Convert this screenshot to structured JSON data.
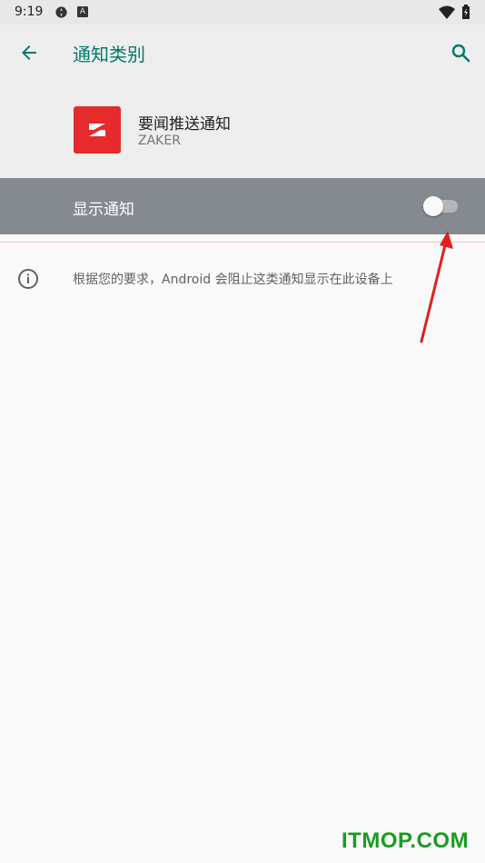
{
  "status_bar": {
    "time": "9:19",
    "icons": [
      "settings-gear-icon",
      "a-badge-icon",
      "wifi-icon",
      "battery-charging-icon"
    ]
  },
  "app_bar": {
    "title": "通知类别",
    "back_icon": "arrow-left-icon",
    "search_icon": "search-icon"
  },
  "header": {
    "app_name": "要闻推送通知",
    "app_sub": "ZAKER",
    "app_icon_color": "#e52b2b"
  },
  "toggle": {
    "label": "显示通知",
    "state": "off"
  },
  "info": {
    "text": "根据您的要求，Android 会阻止这类通知显示在此设备上"
  },
  "watermark": "ITMOP.COM",
  "colors": {
    "accent": "#00796b",
    "toggle_row_bg": "#848a90",
    "app_icon": "#e52b2b",
    "annotation_arrow": "#e02020",
    "watermark": "#1a9c21"
  }
}
